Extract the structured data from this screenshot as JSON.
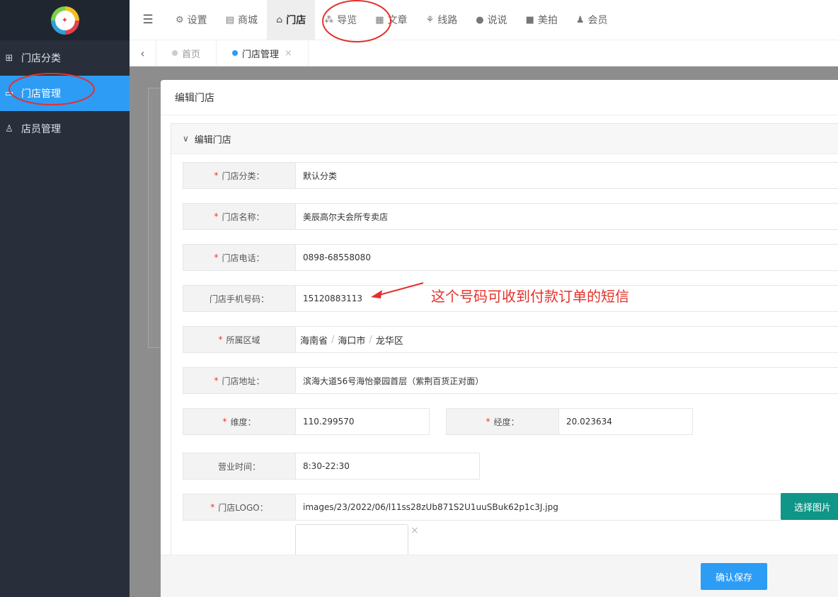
{
  "sidebar": {
    "logo_icon": "brand-logo",
    "items": [
      {
        "label": "门店分类",
        "icon": "sitemap-icon"
      },
      {
        "label": "门店管理",
        "icon": "window-icon"
      },
      {
        "label": "店员管理",
        "icon": "user-icon"
      }
    ]
  },
  "topnav": {
    "menu_icon": "menu-toggle-icon",
    "items": [
      {
        "label": "设置",
        "icon": "gears-icon"
      },
      {
        "label": "商城",
        "icon": "shop-icon"
      },
      {
        "label": "门店",
        "icon": "bank-icon"
      },
      {
        "label": "导览",
        "icon": "cubes-icon"
      },
      {
        "label": "文章",
        "icon": "newspaper-icon"
      },
      {
        "label": "线路",
        "icon": "route-icon"
      },
      {
        "label": "说说",
        "icon": "wechat-icon"
      },
      {
        "label": "美拍",
        "icon": "video-icon"
      },
      {
        "label": "会员",
        "icon": "users-icon"
      }
    ]
  },
  "tabs": {
    "back_icon": "chevron-left-icon",
    "items": [
      {
        "label": "首页"
      },
      {
        "label": "门店管理",
        "close": "×"
      }
    ]
  },
  "modal": {
    "title": "编辑门店",
    "section_title": "编辑门店",
    "fields": {
      "category": {
        "label": "门店分类：",
        "value": "默认分类"
      },
      "name": {
        "label": "门店名称：",
        "value": "美辰高尔夫会所专卖店"
      },
      "phone": {
        "label": "门店电话：",
        "value": "0898-68558080"
      },
      "mobile": {
        "label": "门店手机号码：",
        "value": "15120883113"
      },
      "region": {
        "label": "所属区域",
        "province": "海南省",
        "city": "海口市",
        "district": "龙华区",
        "separator": "/"
      },
      "address": {
        "label": "门店地址：",
        "value": "滨海大道56号海怡豪园首层（紫荆百货正对面）"
      },
      "latitude": {
        "label": "维度：",
        "value": "110.299570"
      },
      "longitude": {
        "label": "经度：",
        "value": "20.023634"
      },
      "hours": {
        "label": "营业时间：",
        "value": "8:30-22:30"
      },
      "logo": {
        "label": "门店LOGO：",
        "value": "images/23/2022/06/l11ss28zUb871S2U1uuSBuk62p1c3J.jpg"
      }
    },
    "required_mark": "*",
    "select_image_button": "选择图片",
    "remove_image": "×",
    "save_button": "确认保存"
  },
  "annotation": {
    "note": "这个号码可收到付款订单的短信",
    "color": "#e4312b"
  },
  "colors": {
    "sidebar_bg": "#282f3a",
    "primary": "#2d9cf5",
    "teal": "#0f9688",
    "required": "#e33"
  }
}
